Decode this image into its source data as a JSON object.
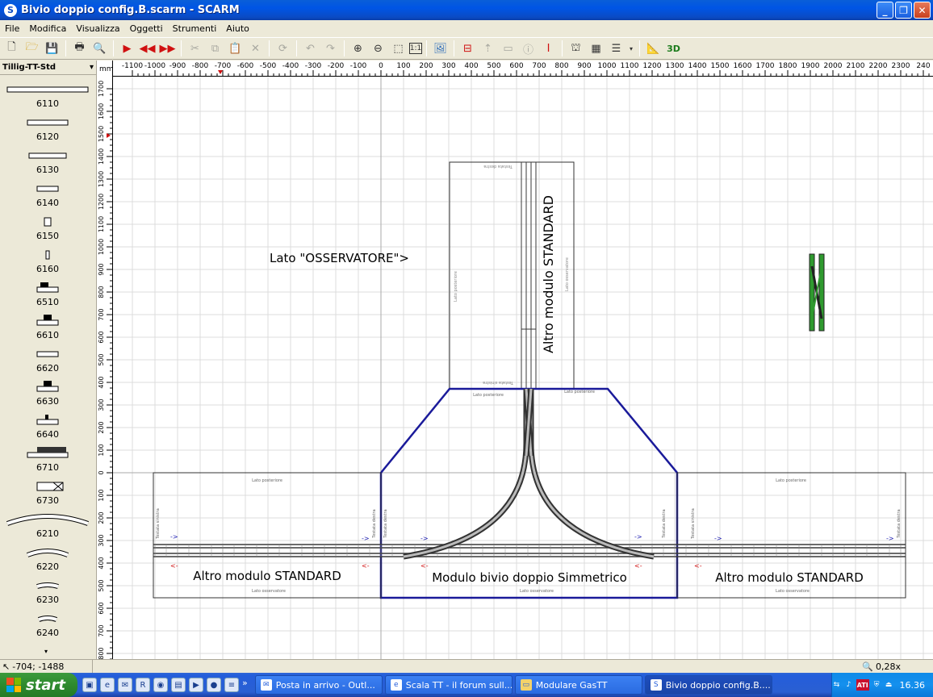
{
  "window": {
    "title": "Bivio doppio config.B.scarm - SCARM",
    "app_icon": "S"
  },
  "menu": [
    "File",
    "Modifica",
    "Visualizza",
    "Oggetti",
    "Strumenti",
    "Aiuto"
  ],
  "toolbar": {
    "items": [
      "new-icon",
      "open-icon",
      "save-icon",
      "sep",
      "print-icon",
      "print-preview-icon",
      "sep",
      "play-icon",
      "step-back-icon",
      "step-forward-icon",
      "sep",
      "cut-icon",
      "copy-icon",
      "paste-icon",
      "delete-icon",
      "sep",
      "rotate-icon",
      "sep",
      "undo-icon",
      "redo-icon",
      "sep",
      "zoom-in-icon",
      "zoom-out-icon",
      "zoom-fit-icon",
      "zoom-1to1-icon",
      "sep",
      "background-image-icon",
      "sep",
      "track-tool-icon",
      "height-icon",
      "label-icon",
      "info-icon",
      "sep",
      "tunnel-icon",
      "bridge-icon",
      "layers-icon",
      "sep",
      "measure-icon",
      "3d-view-icon"
    ],
    "zoom_1to1_label": "1:1",
    "view_3d_label": "3D"
  },
  "library": {
    "name": "Tillig-TT-Std",
    "dropdown_arrow": "▾",
    "scroll_arrow": "▾",
    "parts": [
      "6110",
      "6120",
      "6130",
      "6140",
      "6150",
      "6160",
      "6510",
      "6610",
      "6620",
      "6630",
      "6640",
      "6710",
      "6730",
      "6210",
      "6220",
      "6230",
      "6240"
    ]
  },
  "ruler": {
    "unit": "mm",
    "x_ticks": [
      "-1100",
      "-1000",
      "-900",
      "-800",
      "-700",
      "-600",
      "-500",
      "-400",
      "-300",
      "-200",
      "-100",
      "0",
      "100",
      "200",
      "300",
      "400",
      "500",
      "600",
      "700",
      "800",
      "900",
      "1000",
      "1100",
      "1200",
      "1300",
      "1400",
      "1500",
      "1600",
      "1700",
      "1800",
      "1900",
      "2000",
      "2100",
      "2200",
      "2300",
      "240"
    ],
    "y_ticks": [
      "1700",
      "1600",
      "1500",
      "1400",
      "1300",
      "1200",
      "1100",
      "1000",
      "900",
      "800",
      "700",
      "600",
      "500",
      "400",
      "300",
      "200",
      "100",
      "0",
      "100",
      "200",
      "300",
      "400",
      "500",
      "600",
      "700",
      "800"
    ]
  },
  "layout": {
    "observer_label": "Lato \"OSSERVATORE\">",
    "module_vertical_label": "Altro modulo STANDARD",
    "module_left_label": "Altro modulo STANDARD",
    "module_center_label": "Modulo bivio doppio Simmetrico",
    "module_right_label": "Altro modulo STANDARD",
    "small_posteriore": "Lato posteriore",
    "small_osservatore": "Lato osservatore",
    "small_sinistra": "Testata sinistra",
    "small_destra": "Testata destra",
    "arrow_right": "->",
    "arrow_left": "<-"
  },
  "colors": {
    "grid": "#dcdcdc",
    "module_outline": "#1a1a9a",
    "track": "#3a3a3a",
    "switch_green": "#2f9a2f"
  },
  "status": {
    "coordinates": "-704; -1488",
    "zoom": "0,28x"
  },
  "taskbar": {
    "start_label": "start",
    "chevron": "»",
    "tasks": [
      {
        "label": "Posta in arrivo - Outl...",
        "icon": "outlook-icon",
        "active": false
      },
      {
        "label": "Scala TT - il forum sull...",
        "icon": "ie-icon",
        "active": false
      },
      {
        "label": "Modulare GasTT",
        "icon": "folder-icon",
        "active": false
      },
      {
        "label": "Bivio doppio config.B....",
        "icon": "scarm-icon",
        "active": true
      }
    ],
    "clock": "16.36",
    "tray_ati": "ATI"
  }
}
